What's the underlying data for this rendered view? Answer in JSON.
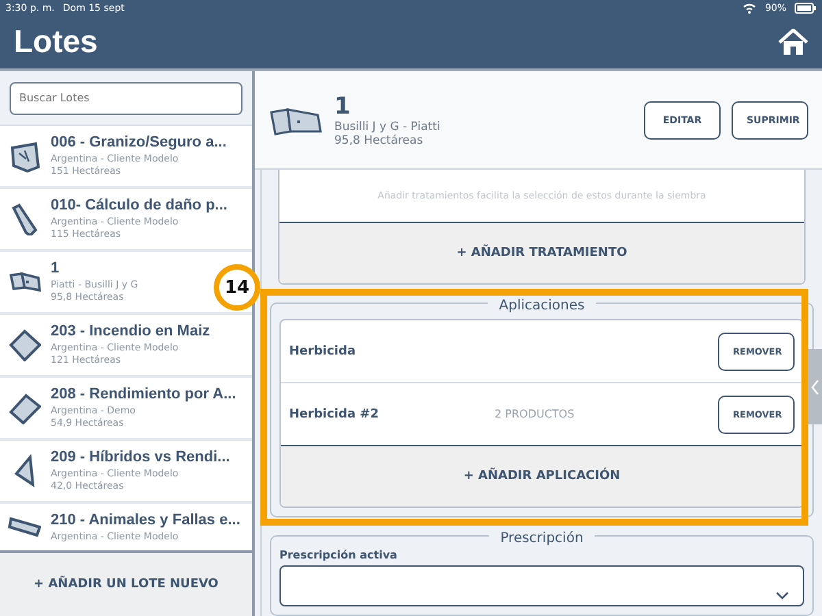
{
  "status_bar": {
    "time": "3:30 p. m.",
    "date": "Dom 15 sept",
    "battery": "90%"
  },
  "header": {
    "title": "Lotes"
  },
  "sidebar": {
    "search": {
      "placeholder": "Buscar Lotes"
    },
    "items": [
      {
        "name": "006 - Granizo/Seguro a...",
        "owner": "Argentina - Cliente Modelo",
        "area": "151 Hectáreas"
      },
      {
        "name": "010- Cálculo de daño p...",
        "owner": "Argentina - Cliente Modelo",
        "area": "115 Hectáreas"
      },
      {
        "name": "1",
        "owner": "Piatti - Busilli J y G",
        "area": "95,8 Hectáreas"
      },
      {
        "name": "203 - Incendio en Maiz",
        "owner": "Argentina - Cliente Modelo",
        "area": "121 Hectáreas"
      },
      {
        "name": "208 - Rendimiento por A...",
        "owner": "Argentina - Demo",
        "area": "54,9 Hectáreas"
      },
      {
        "name": "209 - Híbridos vs Rendi...",
        "owner": "Argentina - Cliente Modelo",
        "area": "42,0 Hectáreas"
      },
      {
        "name": "210 - Animales y Fallas e...",
        "owner": "Argentina - Cliente Modelo"
      }
    ],
    "add_button": "+ AÑADIR UN LOTE NUEVO"
  },
  "detail": {
    "name": "1",
    "owner": "Busilli J y G - Piatti",
    "area": "95,8 Hectáreas",
    "buttons": [
      "EDITAR",
      "SUPRIMIR"
    ],
    "treatments": {
      "hint": "Añadir tratamientos facilita la selección de estos durante la siembra",
      "add_button": "+ AÑADIR TRATAMIENTO"
    },
    "applications": {
      "title": "Aplicaciones",
      "items": [
        {
          "name": "Herbicida",
          "button": "REMOVER"
        },
        {
          "name": "Herbicida #2",
          "products": "2 PRODUCTOS",
          "button": "REMOVER"
        }
      ],
      "add_button": "+ AÑADIR APLICACIÓN"
    },
    "prescription": {
      "title": "Prescripción",
      "label": "Prescripción activa"
    }
  },
  "annotation": {
    "step": "14",
    "highlight": true
  }
}
